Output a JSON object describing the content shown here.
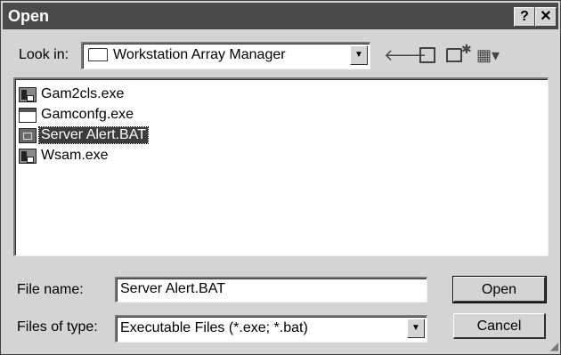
{
  "window": {
    "title": "Open",
    "help_glyph": "?",
    "close_glyph": "✕"
  },
  "lookin": {
    "label": "Look in:",
    "folder": "Workstation Array Manager",
    "folder_icon": "folder-icon",
    "dropdown_glyph": "▼"
  },
  "toolbar": {
    "back_glyph": "🡐",
    "up_glyph": "⮤",
    "newfolder_glyph": "✱",
    "view_glyph": "▦▾"
  },
  "files": [
    {
      "name": "Gam2cls.exe",
      "icon": "application-icon",
      "selected": false
    },
    {
      "name": "Gamconfg.exe",
      "icon": "window-app-icon",
      "selected": false
    },
    {
      "name": "Server Alert.BAT",
      "icon": "batch-file-icon",
      "selected": true
    },
    {
      "name": "Wsam.exe",
      "icon": "application-icon",
      "selected": false
    }
  ],
  "filename": {
    "label": "File name:",
    "value": "Server Alert.BAT"
  },
  "filetype": {
    "label": "Files of type:",
    "value": "Executable Files (*.exe; *.bat)",
    "dropdown_glyph": "▼"
  },
  "buttons": {
    "open": "Open",
    "cancel": "Cancel"
  },
  "colors": {
    "titlebar": "#4a4a4a",
    "face": "#d4d4d4",
    "selection": "#3c3c3c"
  }
}
